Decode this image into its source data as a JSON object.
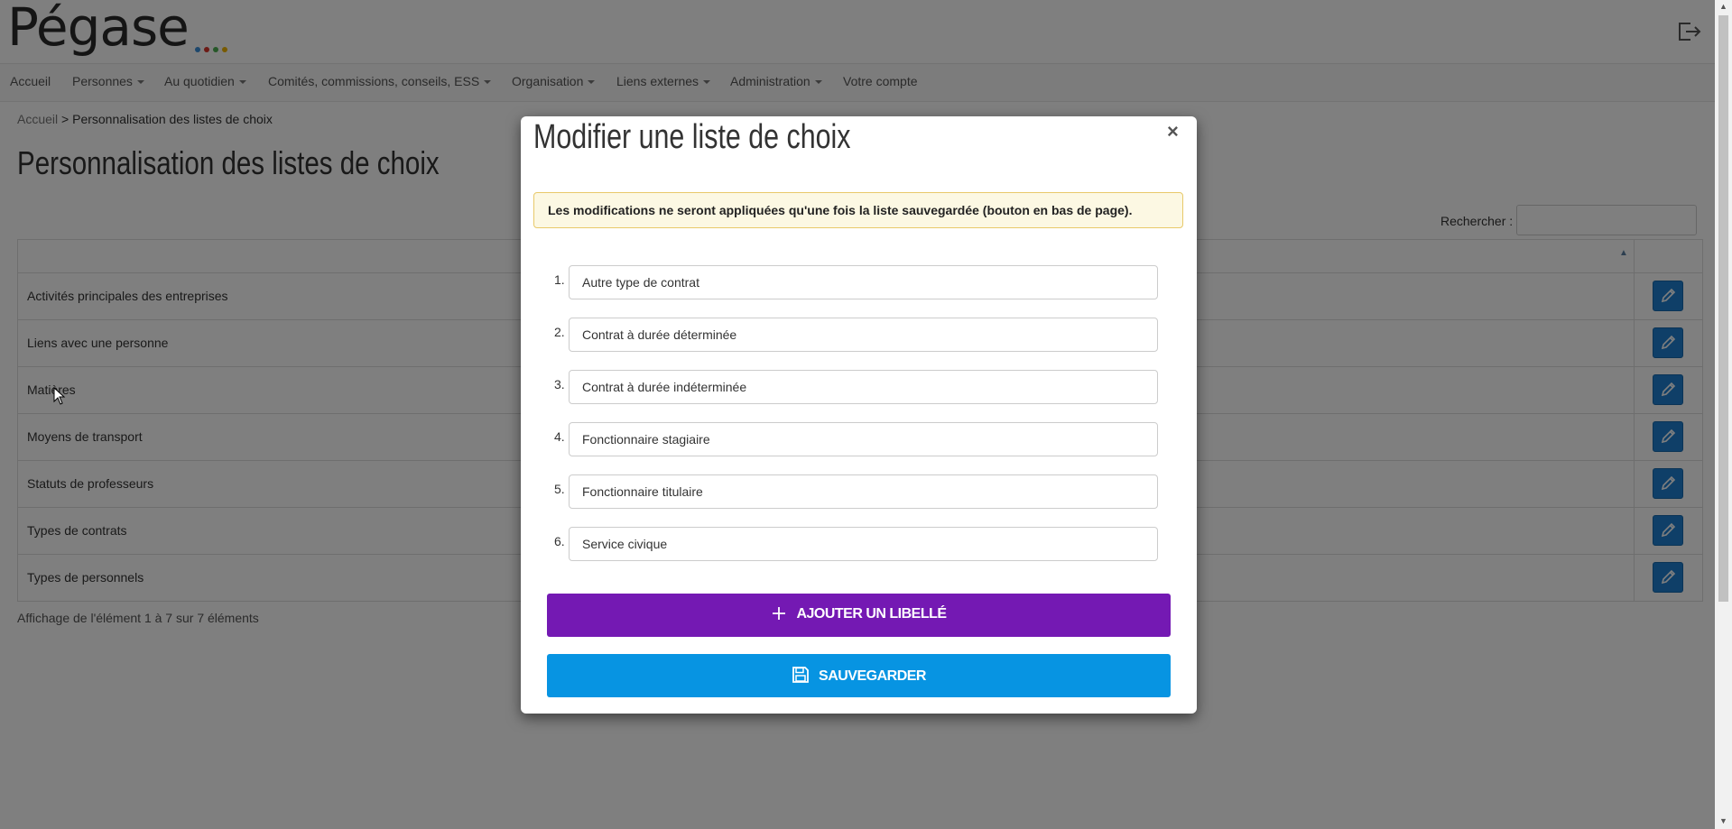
{
  "header": {
    "logo_text": "Pégase",
    "logo_dot_colors": [
      "#3a8fd9",
      "#d9342b",
      "#4caf50",
      "#f0b400"
    ],
    "logout_icon": "logout-icon"
  },
  "nav": {
    "items": [
      {
        "label": "Accueil",
        "dropdown": false
      },
      {
        "label": "Personnes",
        "dropdown": true
      },
      {
        "label": "Au quotidien",
        "dropdown": true
      },
      {
        "label": "Comités, commissions, conseils, ESS",
        "dropdown": true
      },
      {
        "label": "Organisation",
        "dropdown": true
      },
      {
        "label": "Liens externes",
        "dropdown": true
      },
      {
        "label": "Administration",
        "dropdown": true
      },
      {
        "label": "Votre compte",
        "dropdown": false
      }
    ]
  },
  "breadcrumb": {
    "home": "Accueil",
    "separator": ">",
    "current": "Personnalisation des listes de choix"
  },
  "page_title": "Personnalisation des listes de choix",
  "search": {
    "label": "Rechercher :",
    "value": ""
  },
  "table": {
    "rows": [
      "Activités principales des entreprises",
      "Liens avec une personne",
      "Matières",
      "Moyens de transport",
      "Statuts de professeurs",
      "Types de contrats",
      "Types de personnels"
    ],
    "edit_icon": "pencil-icon",
    "info": "Affichage de l'élément 1 à 7 sur 7 éléments"
  },
  "modal": {
    "title": "Modifier une liste de choix",
    "close_label": "×",
    "alert": "Les modifications ne seront appliquées qu'une fois la liste sauvegardée (bouton en bas de page).",
    "items": [
      {
        "num": "1.",
        "value": "Autre type de contrat"
      },
      {
        "num": "2.",
        "value": "Contrat à durée déterminée"
      },
      {
        "num": "3.",
        "value": "Contrat à durée indéterminée"
      },
      {
        "num": "4.",
        "value": "Fonctionnaire stagiaire"
      },
      {
        "num": "5.",
        "value": "Fonctionnaire titulaire"
      },
      {
        "num": "6.",
        "value": "Service civique"
      }
    ],
    "add_label": "AJOUTER UN LIBELLÉ",
    "save_label": "SAUVEGARDER",
    "colors": {
      "add": "#7419b3",
      "save": "#0794e2",
      "alert_bg": "#fcf8e3"
    }
  }
}
